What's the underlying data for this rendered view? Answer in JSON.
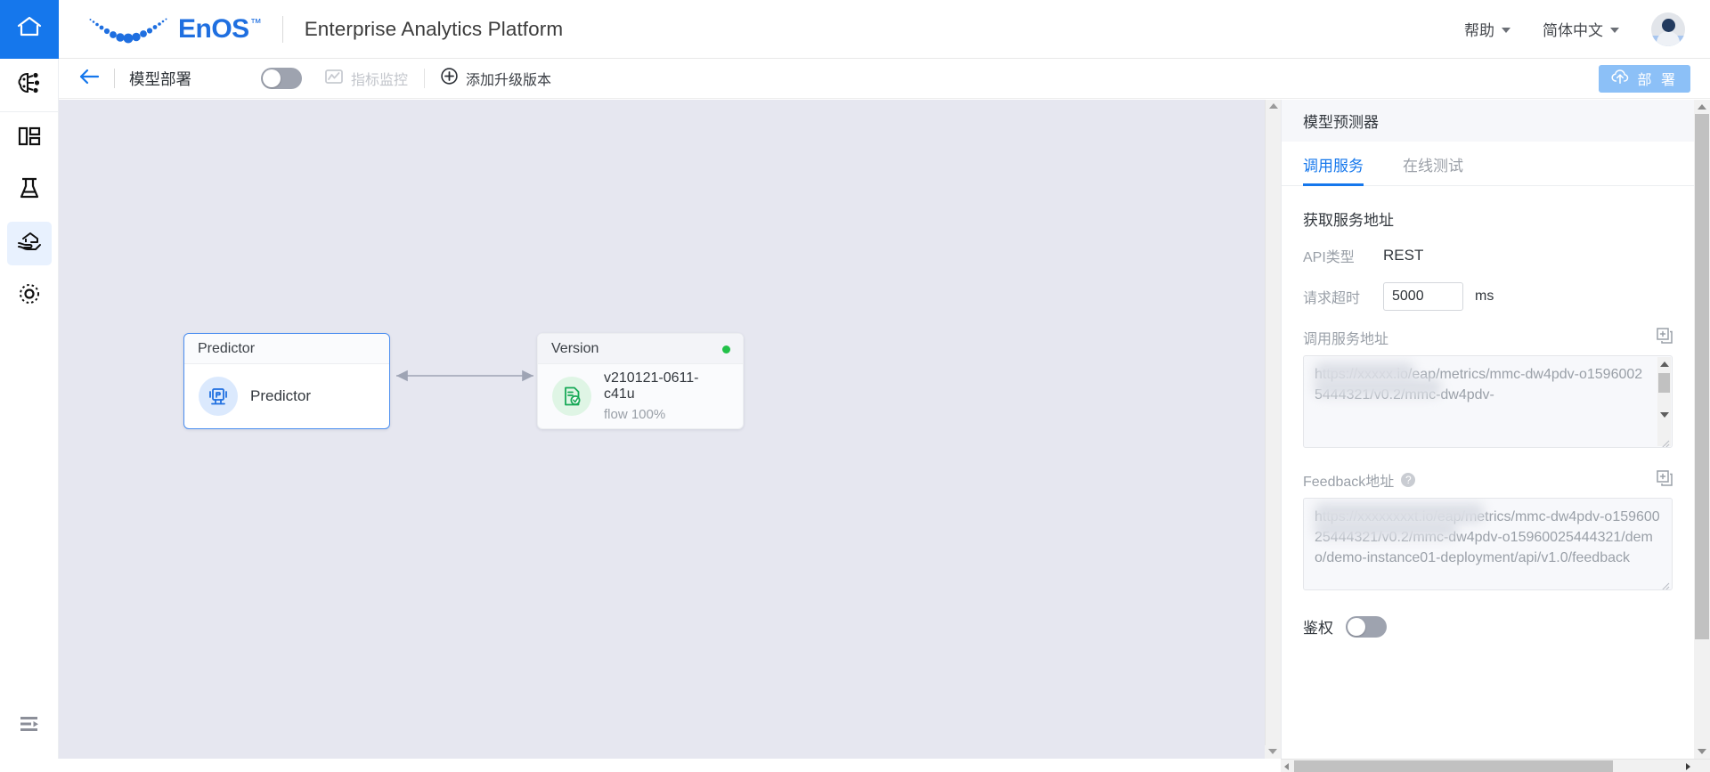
{
  "topbar": {
    "home_icon": "home-icon",
    "brand_name": "EnOS",
    "brand_tm": "™",
    "platform_title": "Enterprise Analytics Platform",
    "help_label": "帮助",
    "language_label": "简体中文",
    "avatar_icon": "user-avatar"
  },
  "rail": {
    "items": [
      {
        "name": "sidebar-item-ai",
        "icon": "brain-network-icon"
      },
      {
        "name": "sidebar-item-dashboard",
        "icon": "layout-blocks-icon"
      },
      {
        "name": "sidebar-item-lab",
        "icon": "flask-icon"
      },
      {
        "name": "sidebar-item-deploy",
        "icon": "hand-deploy-icon",
        "active": true
      },
      {
        "name": "sidebar-item-settings",
        "icon": "gear-dotted-icon"
      }
    ],
    "collapse_icon": "collapse-panel-icon"
  },
  "subbar": {
    "back_icon": "back-arrow-icon",
    "page_title": "模型部署",
    "toggle_state": "off",
    "metric_monitor_label": "指标监控",
    "metric_monitor_icon": "chart-monitor-icon",
    "add_version_label": "添加升级版本",
    "add_version_icon": "plus-circle-icon",
    "deploy_label": "部 署",
    "deploy_icon": "cloud-upload-icon",
    "deploy_color": "#8cc0f7"
  },
  "canvas": {
    "background": "#e6e7f0",
    "predictor_node": {
      "header": "Predictor",
      "icon": "predictor-machine-icon",
      "name": "Predictor",
      "border_color": "#4b8ef0"
    },
    "version_node": {
      "header": "Version",
      "status": "online",
      "status_color": "#22c149",
      "icon": "version-doc-icon",
      "version_id": "v210121-0611-c41u",
      "flow": "flow 100%"
    }
  },
  "panel": {
    "header_title": "模型预测器",
    "tabs": [
      {
        "label": "调用服务",
        "active": true
      },
      {
        "label": "在线测试",
        "active": false
      }
    ],
    "section_title": "获取服务地址",
    "api_type_label": "API类型",
    "api_type_value": "REST",
    "timeout_label": "请求超时",
    "timeout_value": "5000",
    "timeout_unit": "ms",
    "service_addr_label": "调用服务地址",
    "service_addr_copy_icon": "copy-icon",
    "service_addr_value": "https://xxxxx.io/eap/metrics/mmc-dw4pdv-o15960025444321/v0.2/mmc-dw4pdv-",
    "feedback_addr_label": "Feedback地址",
    "feedback_help_icon": "help-question-icon",
    "feedback_addr_copy_icon": "copy-icon",
    "feedback_addr_value": "https://xxxxxxxxt.io/eap/metrics/mmc-dw4pdv-o15960025444321/v0.2/mmc-dw4pdv-o15960025444321/demo/demo-instance01-deployment/api/v1.0/feedback",
    "auth_label": "鉴权",
    "auth_state": "off"
  }
}
